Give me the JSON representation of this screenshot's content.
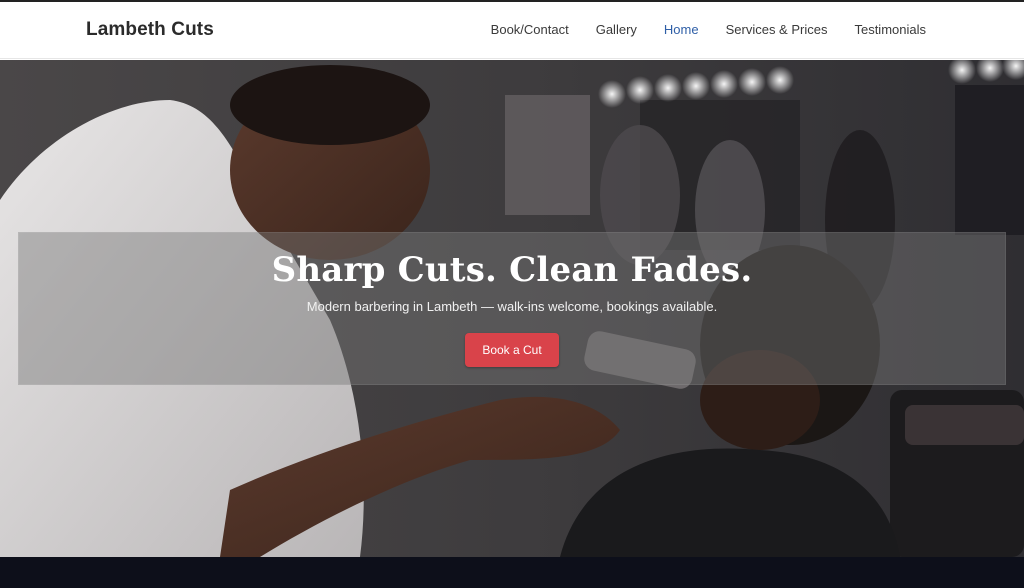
{
  "header": {
    "brand": "Lambeth Cuts",
    "nav": [
      {
        "label": "Book/Contact",
        "active": false
      },
      {
        "label": "Gallery",
        "active": false
      },
      {
        "label": "Home",
        "active": true
      },
      {
        "label": "Services & Prices",
        "active": false
      },
      {
        "label": "Testimonials",
        "active": false
      }
    ]
  },
  "hero": {
    "title": "Sharp Cuts. Clean Fades.",
    "subtitle": "Modern barbering in Lambeth — walk-ins welcome, bookings available.",
    "cta_label": "Book a Cut",
    "image": "barber-cutting-hair-photo"
  },
  "colors": {
    "accent_nav_active": "#2f5fa7",
    "cta": "#d9434a",
    "footer": "#0d0f1a"
  }
}
